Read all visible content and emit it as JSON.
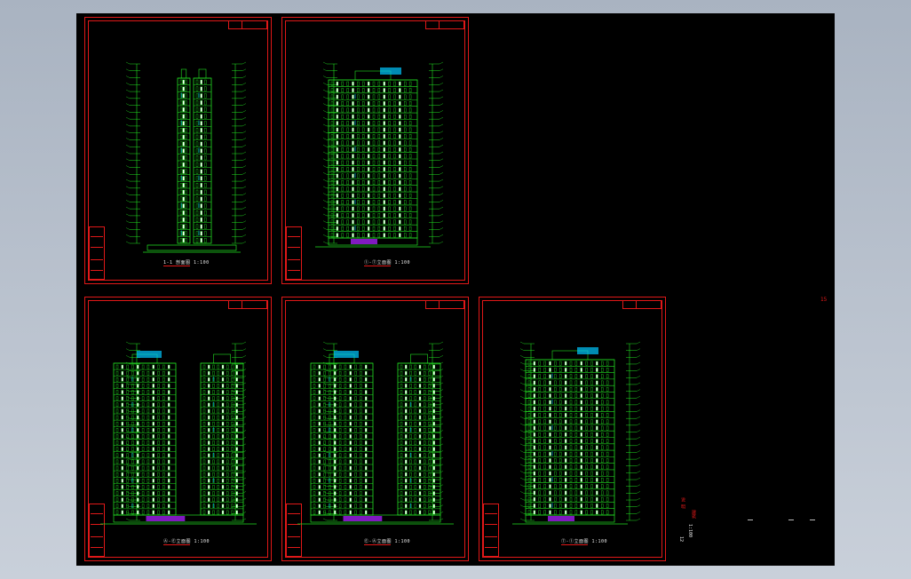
{
  "app": {
    "viewport": "model-space",
    "background_color": "#000000",
    "line_colors": {
      "frame": "#e01818",
      "building": "#22e022",
      "window": "#ffffff",
      "accent": "#a020f0",
      "detail": "#00c8ff"
    }
  },
  "sheets": [
    {
      "id": "section-1-1",
      "caption": "1-1 剖面图 1:100",
      "type": "section"
    },
    {
      "id": "elevation-front",
      "caption": "①-⑦立面图 1:100",
      "type": "elevation"
    },
    {
      "id": "elevation-side-a",
      "caption": "Ⓐ-Ⓔ立面图 1:100",
      "type": "elevation-double"
    },
    {
      "id": "elevation-side-b",
      "caption": "Ⓔ-Ⓐ立面图 1:100",
      "type": "elevation-double"
    },
    {
      "id": "elevation-rear",
      "caption": "⑦-①立面图 1:100",
      "type": "elevation"
    }
  ],
  "sheet_number": "15",
  "legend": {
    "heading": "说 明",
    "notes": [
      "1:100",
      "12",
      "建筑"
    ]
  }
}
